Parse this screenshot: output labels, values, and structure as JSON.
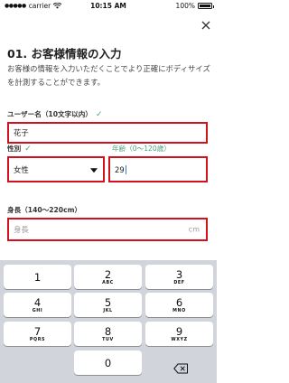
{
  "status_bar": {
    "carrier": "carrier",
    "time": "10:15 AM",
    "battery": "100%",
    "battery_level_percent": 100
  },
  "page": {
    "heading": "01. お客様情報の入力",
    "description": "お客様の情報を入力いただくことでより正確にボディサイズを計測することができます。",
    "close_icon": "close-icon"
  },
  "form": {
    "username": {
      "label": "ユーザー名（10文字以内）",
      "value": "花子",
      "valid_icon": "checkmark-icon"
    },
    "gender": {
      "label": "性別",
      "value": "女性",
      "valid_icon": "checkmark-icon"
    },
    "age": {
      "label": "年齢（0〜120歳）",
      "value": "29"
    },
    "height": {
      "label": "身長（140〜220cm）",
      "placeholder": "身長",
      "unit": "cm"
    }
  },
  "keyboard": {
    "keys": [
      {
        "num": "1",
        "letters": ""
      },
      {
        "num": "2",
        "letters": "ABC"
      },
      {
        "num": "3",
        "letters": "DEF"
      },
      {
        "num": "4",
        "letters": "GHI"
      },
      {
        "num": "5",
        "letters": "JKL"
      },
      {
        "num": "6",
        "letters": "MNO"
      },
      {
        "num": "7",
        "letters": "PQRS"
      },
      {
        "num": "8",
        "letters": "TUV"
      },
      {
        "num": "9",
        "letters": "WXYZ"
      },
      {
        "num": "0",
        "letters": ""
      }
    ],
    "delete_icon": "backspace-icon"
  },
  "colors": {
    "accent": "#4aa37c",
    "highlight_border": "#d3111d",
    "keyboard_bg": "#d1d4da"
  }
}
